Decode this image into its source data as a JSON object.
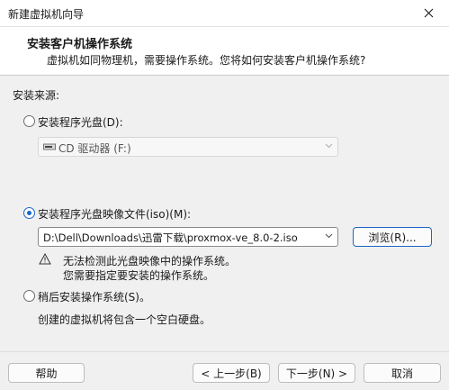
{
  "window": {
    "title": "新建虚拟机向导",
    "close_icon": "close-icon"
  },
  "header": {
    "title": "安装客户机操作系统",
    "subtitle": "虚拟机如同物理机，需要操作系统。您将如何安装客户机操作系统?"
  },
  "source": {
    "label": "安装来源:",
    "disc_option": {
      "label": "安装程序光盘(D):",
      "selected": false,
      "drive_value": "CD 驱动器 (F:)",
      "drive_icon": "cd-drive-icon"
    },
    "iso_option": {
      "label": "安装程序光盘映像文件(iso)(M):",
      "selected": true,
      "path_value": "D:\\Dell\\Downloads\\迅雷下载\\proxmox-ve_8.0-2.iso",
      "browse_label": "浏览(R)...",
      "warning_line1": "无法检测此光盘映像中的操作系统。",
      "warning_line2": "您需要指定要安装的操作系统。",
      "warning_icon": "warning-triangle-icon"
    },
    "later_option": {
      "label": "稍后安装操作系统(S)。",
      "selected": false,
      "note": "创建的虚拟机将包含一个空白硬盘。"
    }
  },
  "footer": {
    "help_label": "帮助",
    "back_label": "< 上一步(B)",
    "next_label": "下一步(N) >",
    "cancel_label": "取消"
  },
  "colors": {
    "accent": "#1a66c8",
    "background": "#f0f0f0",
    "header_bg": "#ffffff"
  }
}
